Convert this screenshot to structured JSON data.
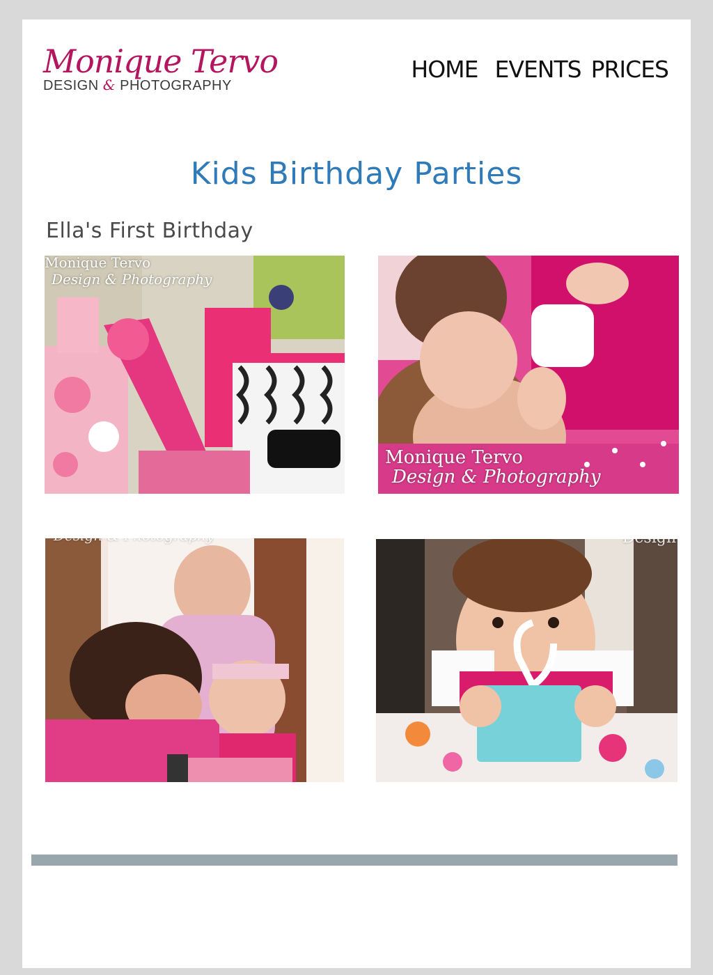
{
  "brand": {
    "name": "Monique Tervo",
    "tagline_left": "DESIGN",
    "tagline_amp": "&",
    "tagline_right": "PHOTOGRAPHY"
  },
  "nav": {
    "items": [
      "HOME",
      "EVENTS",
      "PRICES"
    ]
  },
  "page": {
    "title": "Kids Birthday Parties",
    "section_title": "Ella's First Birthday"
  },
  "photos": {
    "photo1": {
      "wm1": "Monique Tervo",
      "wm2": "Design & Photography"
    },
    "photo2": {
      "wm1": "Monique Tervo",
      "wm2": "Design & Photography"
    },
    "photo3": {
      "wm2": "Design & Photography"
    },
    "photo4": {
      "wm": "Design"
    }
  },
  "colors": {
    "background": "#d9d9d9",
    "brand_pink": "#b3165e",
    "title_blue": "#2f7ab8",
    "footer_bar": "#99a7ad"
  }
}
